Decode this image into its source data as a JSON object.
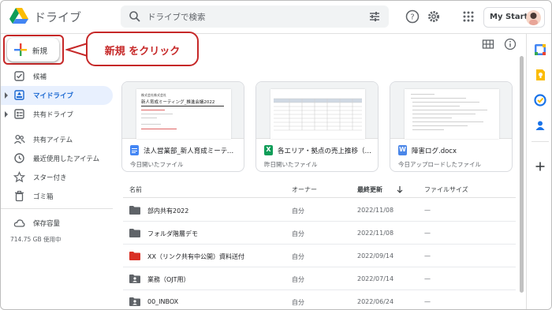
{
  "header": {
    "app_name": "ドライブ",
    "search_placeholder": "ドライブで検索",
    "account_label": "My Start"
  },
  "sidebar": {
    "new_label": "新規",
    "items": [
      {
        "label": "候補",
        "icon": "check-box-icon"
      },
      {
        "label": "マイドライブ",
        "icon": "my-drive-icon",
        "selected": true
      },
      {
        "label": "共有ドライブ",
        "icon": "shared-drive-icon"
      },
      {
        "label": "共有アイテム",
        "icon": "people-icon"
      },
      {
        "label": "最近使用したアイテム",
        "icon": "clock-icon"
      },
      {
        "label": "スター付き",
        "icon": "star-icon"
      },
      {
        "label": "ゴミ箱",
        "icon": "trash-icon"
      },
      {
        "label": "保存容量",
        "icon": "cloud-icon"
      }
    ],
    "storage_text": "714.75 GB 使用中"
  },
  "callout": {
    "text": "新規 をクリック",
    "color": "#c62828"
  },
  "suggested": [
    {
      "title": "法人営業部_新人育成ミーティング_...",
      "subtitle": "今日開いたファイル",
      "type": "docs",
      "color": "#4285f4",
      "preview_lines": [
        "株式会社株式会社",
        "新人育成ミーティング_推進会議2022"
      ]
    },
    {
      "title": "各エリア・拠点の売上推移（上半...",
      "subtitle": "昨日開いたファイル",
      "type": "sheets",
      "color": "#0f9d58"
    },
    {
      "title": "障害ログ.docx",
      "subtitle": "今日アップロードしたファイル",
      "type": "word",
      "color": "#4a86e8",
      "badge": "W"
    }
  ],
  "list": {
    "headers": {
      "name": "名前",
      "owner": "オーナー",
      "modified": "最終更新",
      "size": "ファイルサイズ"
    },
    "rows": [
      {
        "name": "部内共有2022",
        "owner": "自分",
        "date": "2022/11/08",
        "size": "—",
        "icon": "folder-icon",
        "color": "#5f6368"
      },
      {
        "name": "フォルダ階層デモ",
        "owner": "自分",
        "date": "2022/11/08",
        "size": "—",
        "icon": "folder-icon",
        "color": "#5f6368"
      },
      {
        "name": "XX（リンク共有中公開）資料送付",
        "owner": "自分",
        "date": "2022/09/14",
        "size": "—",
        "icon": "folder-icon",
        "color": "#d93025"
      },
      {
        "name": "業務（OJT用）",
        "owner": "自分",
        "date": "2022/07/14",
        "size": "—",
        "icon": "shared-folder-icon",
        "color": "#5f6368"
      },
      {
        "name": "00_INBOX",
        "owner": "自分",
        "date": "2022/06/24",
        "size": "—",
        "icon": "shared-folder-icon",
        "color": "#5f6368"
      }
    ]
  },
  "colors": {
    "accent": "#1a73e8",
    "selected_bg": "#e8f0fe",
    "callout_red": "#c62828"
  }
}
